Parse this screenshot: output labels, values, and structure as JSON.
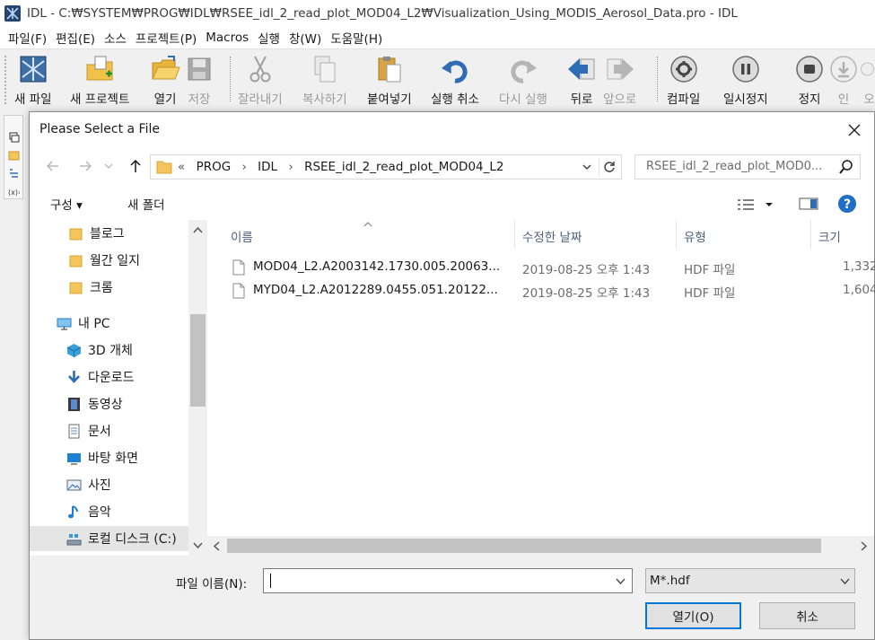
{
  "window": {
    "title": "IDL - C:₩SYSTEM₩PROG₩IDL₩RSEE_idl_2_read_plot_MOD04_L2₩Visualization_Using_MODIS_Aerosol_Data.pro - IDL"
  },
  "menu": [
    "파일(F)",
    "편집(E)",
    "소스",
    "프로젝트(P)",
    "Macros",
    "실행",
    "창(W)",
    "도움말(H)"
  ],
  "toolbar": {
    "new_file": "새 파일",
    "new_project": "새 프로젝트",
    "open": "열기",
    "save": "저장",
    "cut": "잘라내기",
    "copy": "복사하기",
    "paste": "붙여넣기",
    "undo": "실행 취소",
    "redo": "다시 실행",
    "back": "뒤로",
    "forward": "앞으로",
    "compile": "컴파일",
    "pause": "일시정지",
    "stop": "정지",
    "step_in": "인",
    "step_over": "오"
  },
  "dialog": {
    "title": "Please Select a File",
    "address": {
      "overflow": "«",
      "crumbs": [
        "PROG",
        "IDL",
        "RSEE_idl_2_read_plot_MOD04_L2"
      ]
    },
    "search_placeholder": "RSEE_idl_2_read_plot_MOD0...",
    "organize": "구성 ▾",
    "new_folder": "새 폴더",
    "nav": [
      "블로그",
      "월간 일지",
      "크롬",
      "내 PC",
      "3D 개체",
      "다운로드",
      "동영상",
      "문서",
      "바탕 화면",
      "사진",
      "음악",
      "로컬 디스크 (C:)"
    ],
    "columns": {
      "name": "이름",
      "date": "수정한 날짜",
      "type": "유형",
      "size": "크기"
    },
    "files": [
      {
        "name": "MOD04_L2.A2003142.1730.005.20063...",
        "date": "2019-08-25 오후 1:43",
        "type": "HDF 파일",
        "size": "1,332"
      },
      {
        "name": "MYD04_L2.A2012289.0455.051.20122...",
        "date": "2019-08-25 오후 1:43",
        "type": "HDF 파일",
        "size": "1,604"
      }
    ],
    "filename_label": "파일 이름(N):",
    "filename_value": "",
    "filter": "M*.hdf",
    "open_button": "열기(O)",
    "cancel_button": "취소"
  }
}
